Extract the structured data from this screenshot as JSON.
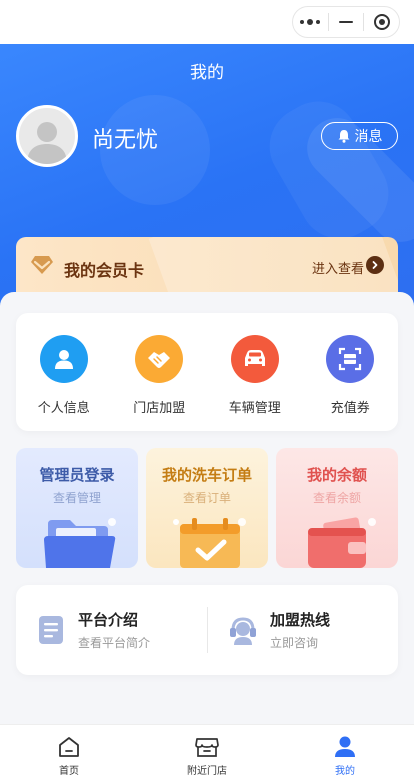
{
  "page": {
    "title": "我的"
  },
  "user": {
    "name": "尚无忧",
    "message_label": "消息"
  },
  "vip": {
    "title": "我的会员卡",
    "enter_label": "进入查看"
  },
  "quick_actions": [
    {
      "label": "个人信息",
      "icon": "user-icon",
      "color": "#1f9ef2"
    },
    {
      "label": "门店加盟",
      "icon": "handshake-icon",
      "color": "#fbaa34"
    },
    {
      "label": "车辆管理",
      "icon": "car-icon",
      "color": "#f35a3c"
    },
    {
      "label": "充值券",
      "icon": "scan-icon",
      "color": "#5a6ee6"
    }
  ],
  "tiles": [
    {
      "title": "管理员登录",
      "subtitle": "查看管理",
      "icon": "folder-icon"
    },
    {
      "title": "我的洗车订单",
      "subtitle": "查看订单",
      "icon": "calendar-check-icon"
    },
    {
      "title": "我的余额",
      "subtitle": "查看余额",
      "icon": "wallet-icon"
    }
  ],
  "info": [
    {
      "title": "平台介绍",
      "subtitle": "查看平台简介",
      "icon": "document-icon"
    },
    {
      "title": "加盟热线",
      "subtitle": "立即咨询",
      "icon": "headset-icon"
    }
  ],
  "tabbar": [
    {
      "label": "首页",
      "icon": "home-icon",
      "active": false
    },
    {
      "label": "附近门店",
      "icon": "store-icon",
      "active": false
    },
    {
      "label": "我的",
      "icon": "profile-icon",
      "active": true
    }
  ],
  "colors": {
    "primary": "#2f6ff5",
    "vip_text": "#6b3411"
  }
}
